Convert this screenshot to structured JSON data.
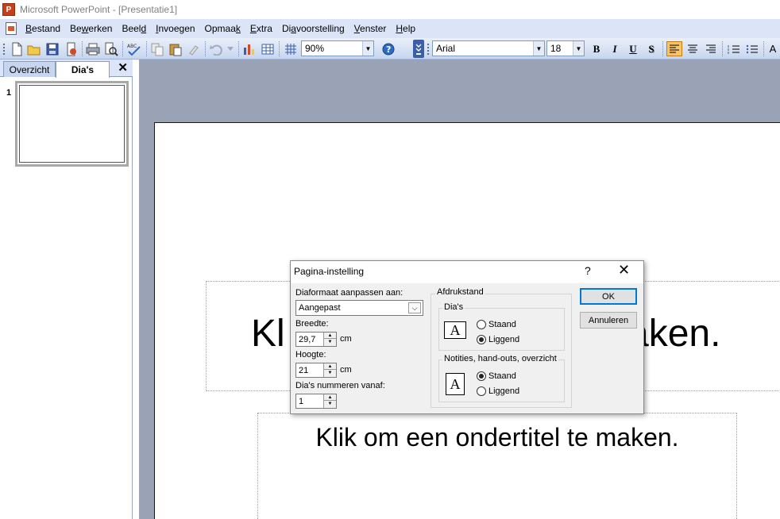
{
  "window": {
    "title": "Microsoft PowerPoint - [Presentatie1]"
  },
  "menu": {
    "items": [
      {
        "pre": "",
        "key": "B",
        "post": "estand"
      },
      {
        "pre": "Be",
        "key": "w",
        "post": "erken"
      },
      {
        "pre": "Beel",
        "key": "d",
        "post": ""
      },
      {
        "pre": "",
        "key": "I",
        "post": "nvoegen"
      },
      {
        "pre": "Opmaa",
        "key": "k",
        "post": ""
      },
      {
        "pre": "",
        "key": "E",
        "post": "xtra"
      },
      {
        "pre": "Di",
        "key": "a",
        "post": "voorstelling"
      },
      {
        "pre": "",
        "key": "V",
        "post": "enster"
      },
      {
        "pre": "",
        "key": "H",
        "post": "elp"
      }
    ]
  },
  "toolbar": {
    "zoom": "90%",
    "font": "Arial",
    "size": "18",
    "bold": "B",
    "italic": "I",
    "underline": "U",
    "shadow": "S",
    "grow": "A"
  },
  "left_pane": {
    "tab_overview": "Overzicht",
    "tab_slides": "Dia's",
    "close": "✕",
    "slide_number": "1"
  },
  "slide": {
    "title_left": "Kl",
    "title_right": "aken.",
    "subtitle": "Klik om een ondertitel te maken."
  },
  "dialog": {
    "title": "Pagina-instelling",
    "help": "?",
    "close": "✕",
    "size_label": "Diaformaat aanpassen aan:",
    "size_value": "Aangepast",
    "width_label": "Breedte:",
    "width_value": "29,7",
    "width_unit": "cm",
    "height_label": "Hoogte:",
    "height_value": "21",
    "height_unit": "cm",
    "number_label": "Dia's nummeren vanaf:",
    "number_value": "1",
    "orientation_label": "Afdrukstand",
    "slides_group": "Dia's",
    "notes_group": "Notities, hand-outs, overzicht",
    "portrait": "Staand",
    "landscape": "Liggend",
    "ok": "OK",
    "cancel": "Annuleren"
  }
}
